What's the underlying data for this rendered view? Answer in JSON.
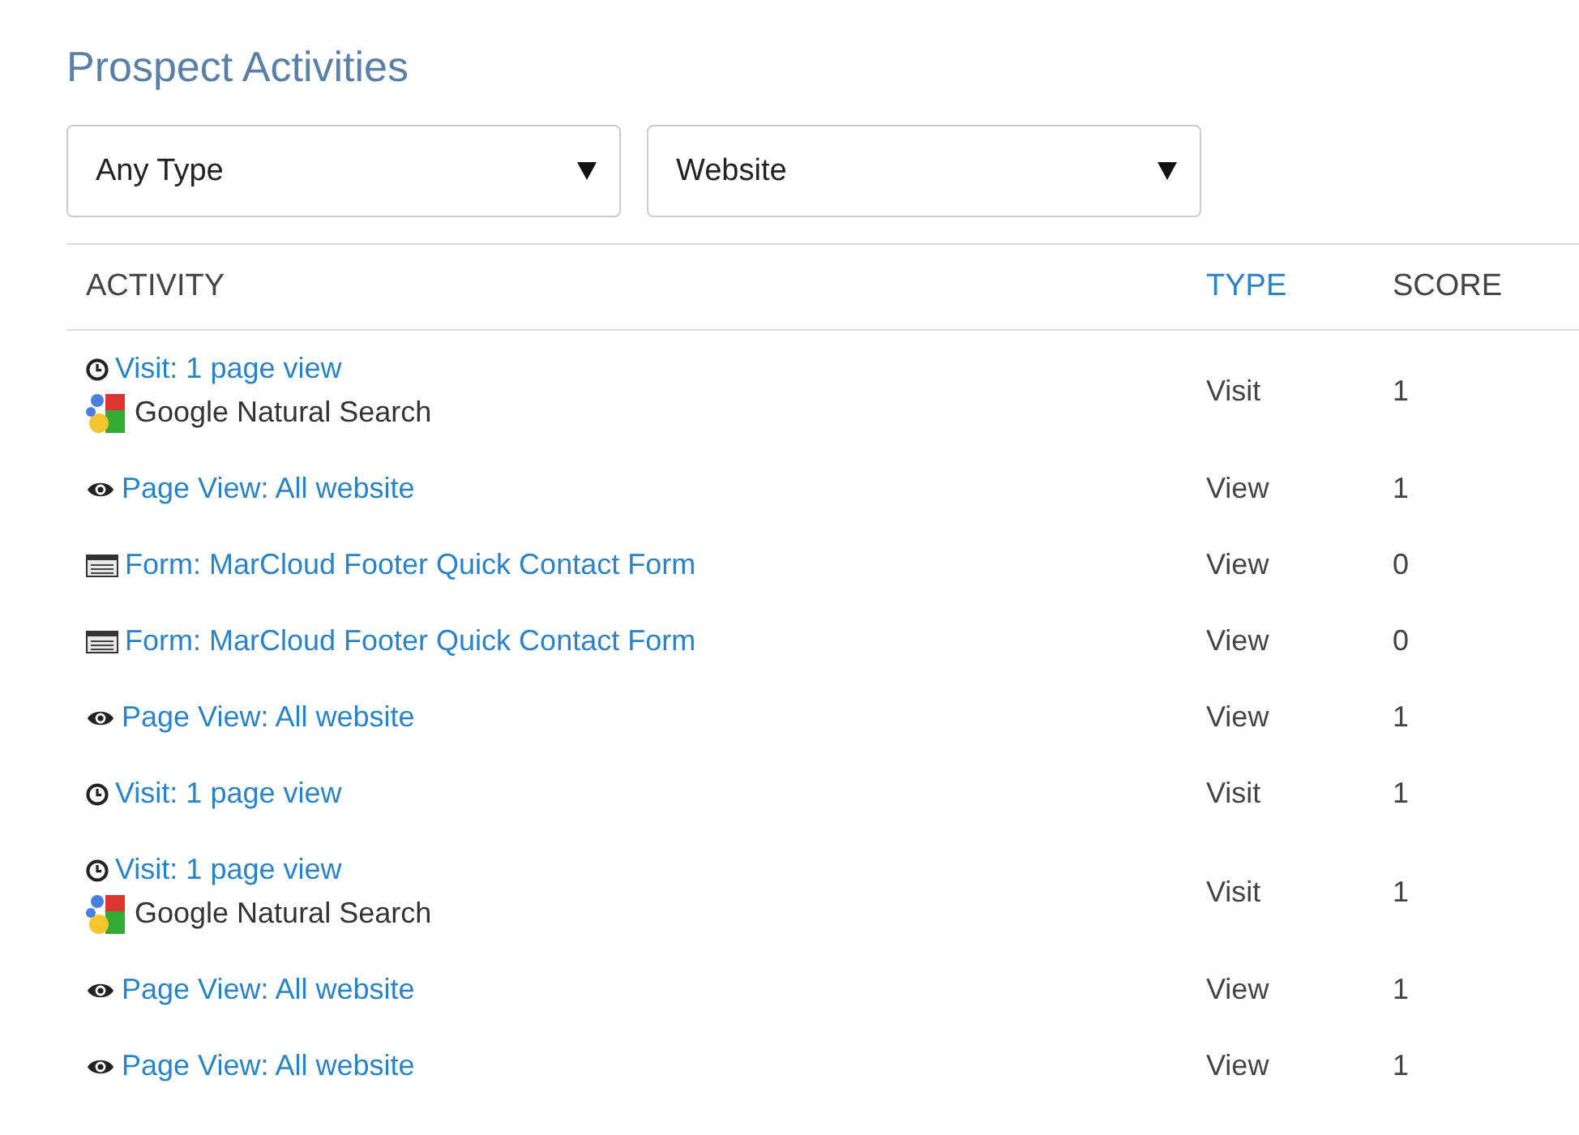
{
  "title": "Prospect Activities",
  "filters": [
    {
      "value": "Any Type"
    },
    {
      "value": "Website"
    }
  ],
  "table": {
    "columns": [
      {
        "label": "ACTIVITY",
        "selected": false
      },
      {
        "label": "TYPE",
        "selected": true
      },
      {
        "label": "SCORE",
        "selected": false
      }
    ],
    "rows": [
      {
        "kind": "visit",
        "activity": "Visit: 1 page view",
        "source": "Google Natural Search",
        "type": "Visit",
        "score": "1"
      },
      {
        "kind": "view",
        "activity": "Page View: All website",
        "type": "View",
        "score": "1"
      },
      {
        "kind": "form",
        "activity": "Form: MarCloud Footer Quick Contact Form",
        "type": "View",
        "score": "0"
      },
      {
        "kind": "form",
        "activity": "Form: MarCloud Footer Quick Contact Form",
        "type": "View",
        "score": "0"
      },
      {
        "kind": "view",
        "activity": "Page View: All website",
        "type": "View",
        "score": "1"
      },
      {
        "kind": "visit",
        "activity": "Visit: 1 page view",
        "type": "Visit",
        "score": "1"
      },
      {
        "kind": "visit",
        "activity": "Visit: 1 page view",
        "source": "Google Natural Search",
        "type": "Visit",
        "score": "1"
      },
      {
        "kind": "view",
        "activity": "Page View: All website",
        "type": "View",
        "score": "1"
      },
      {
        "kind": "view",
        "activity": "Page View: All website",
        "type": "View",
        "score": "1"
      }
    ]
  }
}
